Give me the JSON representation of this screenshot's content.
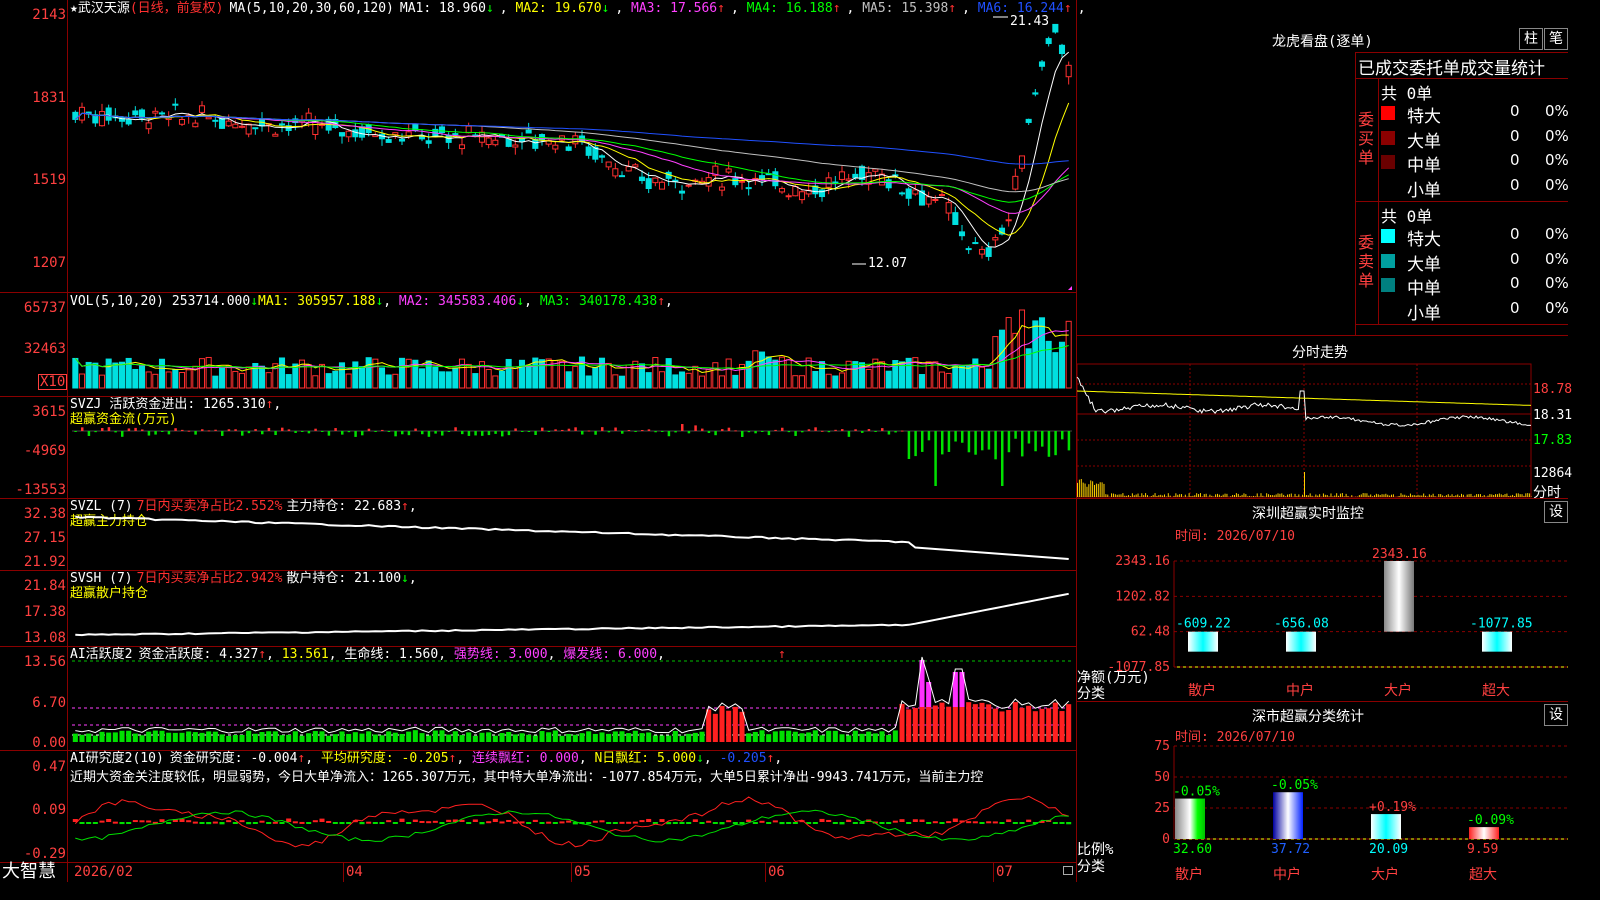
{
  "app": {
    "brand": "大智慧"
  },
  "main": {
    "star": "★",
    "stock_name": "武汉天源",
    "period": "(日线，前复权)",
    "ma_params": "MA(5,10,20,30,60,120)",
    "ma": [
      {
        "text": "MA1: 18.960",
        "arrow": "↓",
        "color": "#ffffff"
      },
      {
        "text": "MA2: 19.670",
        "arrow": "↓",
        "color": "#ffff00"
      },
      {
        "text": "MA3: 17.566",
        "arrow": "↑",
        "color": "#ff40ff"
      },
      {
        "text": "MA4: 16.188",
        "arrow": "↑",
        "color": "#00ff00"
      },
      {
        "text": "MA5: 15.398",
        "arrow": "↑",
        "color": "#c0c0c0"
      },
      {
        "text": "MA6: 16.244",
        "arrow": "↑",
        "color": "#2050ff"
      }
    ],
    "ylabels": [
      "2143",
      "1831",
      "1519",
      "1207"
    ],
    "high_label": "21.43",
    "low_label": "12.07"
  },
  "vol": {
    "title": "VOL(5,10,20)",
    "value": "253714.000",
    "ma": [
      {
        "text": "MA1: 305957.188",
        "arrow": "↓",
        "color": "#ffff00"
      },
      {
        "text": "MA2: 345583.406",
        "arrow": "↓",
        "color": "#ff40ff"
      },
      {
        "text": "MA3: 340178.438",
        "arrow": "↑",
        "color": "#00ff00"
      }
    ],
    "ylabels": [
      "65737",
      "32463"
    ],
    "unit": "X10"
  },
  "svzj": {
    "title": "SVZJ",
    "label": "活跃资金进出: 1265.310",
    "arrow": "↑",
    "sub": "超赢资金流(万元)",
    "ylabels": [
      "3615",
      "-4969",
      "-13553"
    ]
  },
  "svzl": {
    "title": "SVZL (7)",
    "red": "7日内买卖净占比2.552%",
    "label": "主力持仓: 22.683",
    "arrow": "↑",
    "sub": "超赢主力持仓",
    "ylabels": [
      "32.38",
      "27.15",
      "21.92"
    ]
  },
  "svsh": {
    "title": "SVSH (7)",
    "red": "7日内买卖净占比2.942%",
    "label": "散户持仓: 21.100",
    "arrow": "↓",
    "sub": "超赢散户持仓",
    "ylabels": [
      "21.84",
      "17.38",
      "13.08"
    ]
  },
  "ai2": {
    "title": "AI活跃度2",
    "items": [
      {
        "text": "资金活跃度: 4.327",
        "arrow": "↑",
        "color": "#ffffff"
      },
      {
        "text": "13.561",
        "arrow": "",
        "color": "#ffff00"
      },
      {
        "text": "生命线: 1.560",
        "arrow": "",
        "color": "#ffffff"
      },
      {
        "text": "强势线: 3.000",
        "arrow": "",
        "color": "#ff40ff"
      },
      {
        "text": "爆发线: 6.000",
        "arrow": "",
        "color": "#ff40ff"
      }
    ],
    "ylabels": [
      "13.56",
      "6.70",
      "0.00"
    ]
  },
  "air": {
    "title": "AI研究度2(10)",
    "items": [
      {
        "text": "资金研究度: -0.004",
        "arrow": "↑",
        "color": "#ffffff"
      },
      {
        "text": "平均研究度: -0.205",
        "arrow": "↑",
        "color": "#ffff00"
      },
      {
        "text": "连续飘红: 0.000",
        "arrow": "",
        "color": "#ff40ff"
      },
      {
        "text": "N日飘红: 5.000",
        "arrow": "↓",
        "color": "#ffff00"
      },
      {
        "text": "-0.205",
        "arrow": "↑",
        "color": "#2050ff"
      }
    ],
    "comment": "近期大资金关注度较低，明显弱势，今日大单净流入：1265.307万元，其中特大单净流出：-1077.854万元，大单5日累计净出-9943.741万元，当前主力控",
    "ylabels": [
      "0.47",
      "0.09",
      "-0.29"
    ]
  },
  "dates": [
    "2026/02",
    "04",
    "05",
    "06",
    "07"
  ],
  "lhb": {
    "title": "龙虎看盘(逐单)",
    "btn1": "柱",
    "btn2": "笔",
    "header": "已成交委托单成交量统计",
    "buy_label": "委买单",
    "sell_label": "委卖单",
    "buy_total": "共 0单",
    "sell_total": "共 0单",
    "rows": [
      {
        "name": "特大",
        "n": "0",
        "p": "0%"
      },
      {
        "name": "大单",
        "n": "0",
        "p": "0%"
      },
      {
        "name": "中单",
        "n": "0",
        "p": "0%"
      },
      {
        "name": "小单",
        "n": "0",
        "p": "0%"
      }
    ],
    "buy_colors": [
      "#ff0000",
      "#8b0000",
      "#6a0000",
      ""
    ],
    "sell_colors": [
      "#00ffff",
      "#00a0a0",
      "#008080",
      ""
    ]
  },
  "intraday": {
    "title": "分时走势",
    "prices": [
      "18.78",
      "18.31",
      "17.83"
    ],
    "vol_label": "12864",
    "tab": "分时"
  },
  "monitor": {
    "title": "深圳超赢实时监控",
    "btn": "设",
    "time_label": "时间: 2026/07/10",
    "ylabels": [
      "2343.16",
      "1202.82",
      "62.48",
      "-1077.85"
    ],
    "y_title": "净额(万元)",
    "x_title": "分类",
    "cats": [
      "散户",
      "中户",
      "大户",
      "超大"
    ],
    "values": [
      -609.22,
      -656.08,
      2343.16,
      -1077.85
    ],
    "value_labels": [
      "-609.22",
      "-656.08",
      "2343.16",
      "-1077.85"
    ],
    "ylim": [
      -1077.85,
      2343.16
    ]
  },
  "stats": {
    "title": "深市超赢分类统计",
    "btn": "设",
    "time_label": "时间: 2026/07/10",
    "ylabels": [
      "75",
      "50",
      "25",
      "0"
    ],
    "y_title": "比例%",
    "x_title": "分类",
    "cats": [
      "散户",
      "中户",
      "大户",
      "超大"
    ],
    "values": [
      32.6,
      37.72,
      20.09,
      9.59
    ],
    "value_labels": [
      "32.60",
      "37.72",
      "20.09",
      "9.59"
    ],
    "changes": [
      "-0.05%",
      "-0.05%",
      "+0.19%",
      "-0.09%"
    ],
    "ylim": [
      0,
      75
    ]
  }
}
